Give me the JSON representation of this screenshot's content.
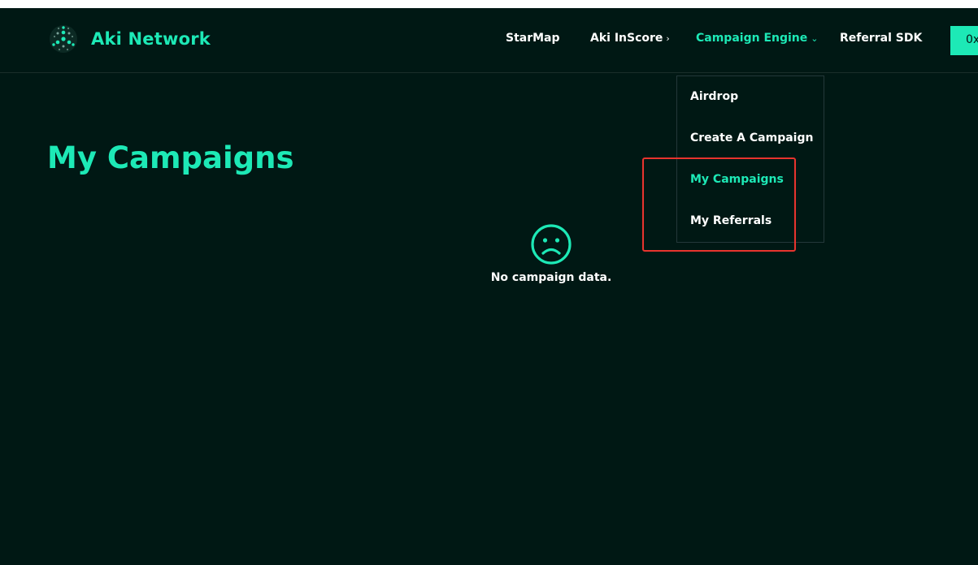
{
  "brand": {
    "name": "Aki Network"
  },
  "nav": {
    "items": [
      {
        "label": "StarMap",
        "chevron": ""
      },
      {
        "label": "Aki InScore",
        "chevron": "›"
      },
      {
        "label": "Campaign Engine",
        "chevron": "⌄"
      },
      {
        "label": "Referral SDK",
        "chevron": ""
      }
    ],
    "wallet_label": "0x"
  },
  "dropdown": {
    "items": [
      {
        "label": "Airdrop"
      },
      {
        "label": "Create A Campaign"
      },
      {
        "label": "My Campaigns"
      },
      {
        "label": "My Referrals"
      }
    ]
  },
  "main": {
    "title": "My Campaigns",
    "empty_text": "No campaign data."
  },
  "colors": {
    "background": "#001814",
    "accent": "#1de9b6",
    "text": "#ffffff",
    "annotation": "#e8342e"
  },
  "icons": {
    "logo": "aki-logo-icon",
    "empty": "sad-face-icon"
  }
}
